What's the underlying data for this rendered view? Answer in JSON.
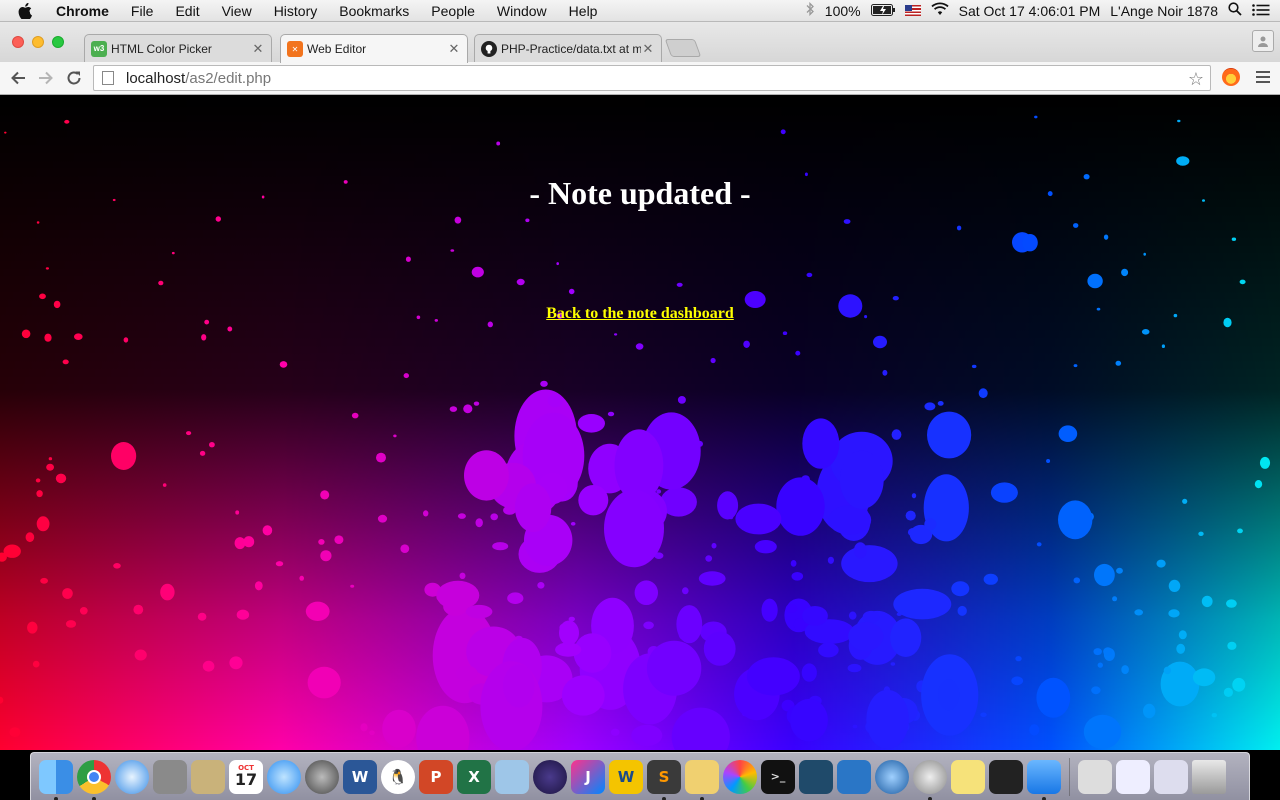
{
  "menubar": {
    "app_name": "Chrome",
    "items": [
      "File",
      "Edit",
      "View",
      "History",
      "Bookmarks",
      "People",
      "Window",
      "Help"
    ],
    "battery": "100%",
    "datetime": "Sat Oct 17  4:06:01 PM",
    "user": "L'Ange Noir 1878"
  },
  "tabs": [
    {
      "title": "HTML Color Picker",
      "icon": "w3schools-icon",
      "active": false
    },
    {
      "title": "Web Editor",
      "icon": "xampp-icon",
      "active": true
    },
    {
      "title": "PHP-Practice/data.txt at m",
      "icon": "github-icon",
      "active": false
    }
  ],
  "address_bar": {
    "host": "localhost",
    "path": "/as2/edit.php"
  },
  "page": {
    "heading": "- Note updated -",
    "link_text": "Back to the note dashboard",
    "link_color": "#ffff00"
  },
  "dock": {
    "calendar_month": "OCT",
    "calendar_day": "17",
    "apps": [
      "finder-icon",
      "chrome-icon",
      "safari-icon",
      "calculator-icon",
      "preview-icon",
      "calendar-icon",
      "messages-icon",
      "system-preferences-icon",
      "word-icon",
      "qq-icon",
      "powerpoint-icon",
      "excel-icon",
      "virtualbox-icon",
      "eclipse-icon",
      "intellij-icon",
      "wunderlist-icon",
      "sublime-text-icon",
      "stickies-icon",
      "photos-icon",
      "terminal-icon",
      "mysql-workbench-icon",
      "xcode-icon",
      "quicktime-icon",
      "settings-icon",
      "notes-icon",
      "printer-icon",
      "icloud-icon",
      "archive-utility-icon",
      "preview-window-icon",
      "folder-stack-icon",
      "trash-icon"
    ]
  }
}
